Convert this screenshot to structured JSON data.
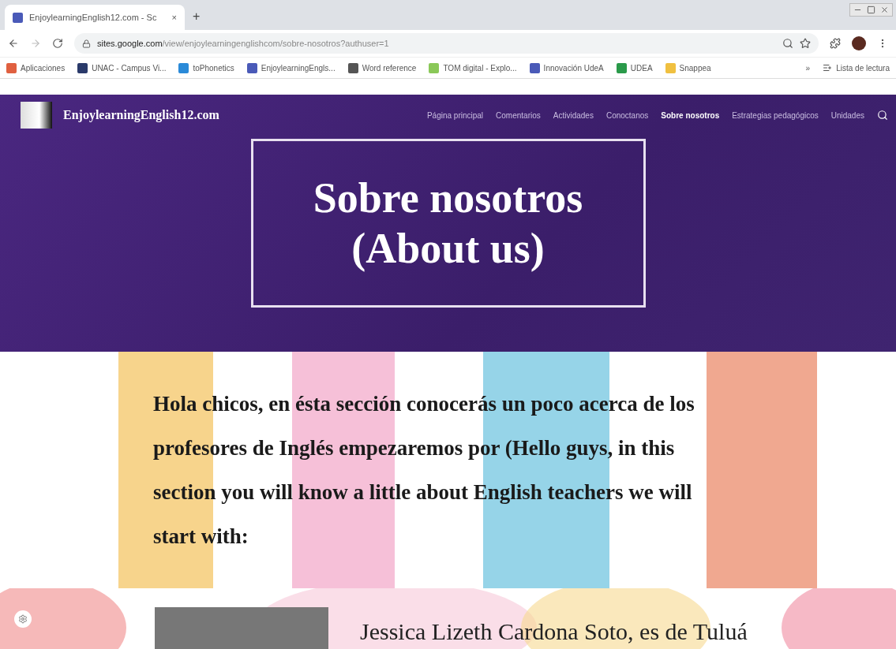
{
  "browser": {
    "tab": {
      "title": "EnjoylearningEnglish12.com - Sc",
      "close": "×"
    },
    "new_tab": "+",
    "url": {
      "host": "sites.google.com",
      "path": "/view/enjoylearningenglishcom/sobre-nosotros?authuser=1"
    },
    "bookmarks": [
      {
        "label": "Aplicaciones",
        "color": "#e06040"
      },
      {
        "label": "UNAC - Campus Vi...",
        "color": "#2a3a6a"
      },
      {
        "label": "toPhonetics",
        "color": "#2a8ad8"
      },
      {
        "label": "EnjoylearningEngls...",
        "color": "#4a5ab8"
      },
      {
        "label": "Word reference",
        "color": "#555555"
      },
      {
        "label": "TOM digital - Explo...",
        "color": "#8ac858"
      },
      {
        "label": "Innovación UdeA",
        "color": "#4a5ab8"
      },
      {
        "label": "UDEA",
        "color": "#2a9a4a"
      },
      {
        "label": "Snappea",
        "color": "#f0c040"
      }
    ],
    "more": "»",
    "reading_list": "Lista de lectura"
  },
  "site": {
    "name": "EnjoylearningEnglish12.com",
    "nav": [
      {
        "label": "Página principal",
        "selected": false
      },
      {
        "label": "Comentarios",
        "selected": false
      },
      {
        "label": "Actividades",
        "selected": false
      },
      {
        "label": "Conoctanos",
        "selected": false
      },
      {
        "label": "Sobre nosotros",
        "selected": true
      },
      {
        "label": "Estrategias pedagógicos",
        "selected": false
      },
      {
        "label": "Unidades",
        "selected": false
      }
    ],
    "hero_title": [
      "Sobre nosotros",
      "(About us)"
    ],
    "intro": "Hola chicos, en ésta sección conocerás un poco acerca de los profesores de Inglés empezaremos por (Hello guys, in this section you will know a little about English teachers we will start with:",
    "profile_heading": "Jessica Lizeth Cardona Soto, es de Tuluá"
  }
}
